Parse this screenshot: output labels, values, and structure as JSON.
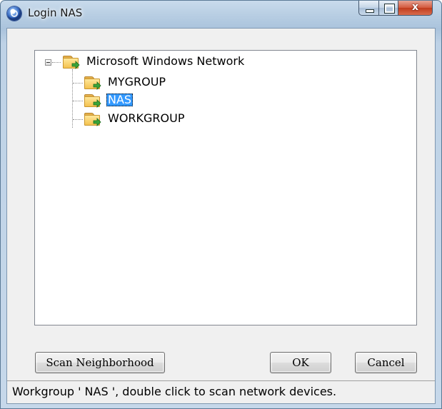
{
  "window": {
    "title": "Login NAS",
    "caption_close_glyph": "x"
  },
  "tree": {
    "root": {
      "label": "Microsoft Windows Network",
      "icon": "network-folder-icon",
      "expanded": true
    },
    "children": [
      {
        "label": "MYGROUP",
        "icon": "network-folder-icon",
        "selected": false
      },
      {
        "label": "NAS",
        "icon": "network-folder-icon",
        "selected": true
      },
      {
        "label": "WORKGROUP",
        "icon": "network-folder-icon",
        "selected": false
      }
    ]
  },
  "buttons": {
    "scan": "Scan Neighborhood",
    "ok": "OK",
    "cancel": "Cancel"
  },
  "status": {
    "text": "Workgroup ' NAS ', double click to scan network devices."
  },
  "colors": {
    "selection": "#3399ff",
    "folder": "#f4c24f",
    "folder_arrow": "#3aa53a",
    "close_button": "#c13b1c"
  }
}
